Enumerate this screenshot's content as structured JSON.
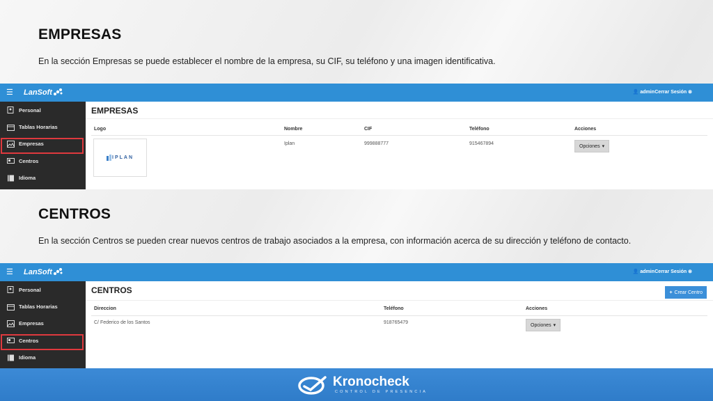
{
  "section1": {
    "title": "EMPRESAS",
    "description": "En la sección Empresas se puede establecer el nombre de la empresa, su CIF, su teléfono y una imagen identificativa."
  },
  "section2": {
    "title": "CENTROS",
    "description": "En la sección Centros se pueden crear nuevos centros de trabajo asociados a la empresa, con información acerca de su dirección y teléfono de contacto."
  },
  "app": {
    "logo": "LanSoft",
    "user": "admin",
    "logout": "Cerrar Sesión",
    "sidebar": [
      {
        "label": "Personal",
        "icon": "badge-icon"
      },
      {
        "label": "Tablas Horarias",
        "icon": "calendar-icon"
      },
      {
        "label": "Empresas",
        "icon": "image-icon"
      },
      {
        "label": "Centros",
        "icon": "id-card-icon"
      },
      {
        "label": "Idioma",
        "icon": "book-icon"
      }
    ]
  },
  "empresas": {
    "title": "EMPRESAS",
    "headers": [
      "Logo",
      "Nombre",
      "CIF",
      "Teléfono",
      "Acciones"
    ],
    "row": {
      "logo_text": "IPLAN",
      "nombre": "Iplan",
      "cif": "999888777",
      "telefono": "915467894",
      "acciones": "Opciones"
    }
  },
  "centros": {
    "title": "CENTROS",
    "create_button": "Crear Centro",
    "headers": [
      "Direccion",
      "Teléfono",
      "Acciones"
    ],
    "row": {
      "direccion": "C/ Federico de los Santos",
      "telefono": "918765479",
      "acciones": "Opciones"
    }
  },
  "footer": {
    "brand": "Kronocheck",
    "tagline": "CONTROL DE PRESENCIA"
  },
  "colors": {
    "topbar": "#2f8fd6",
    "sidebar": "#2a2a2a",
    "highlight": "#e0393e",
    "footer": "#3c8ad6"
  }
}
